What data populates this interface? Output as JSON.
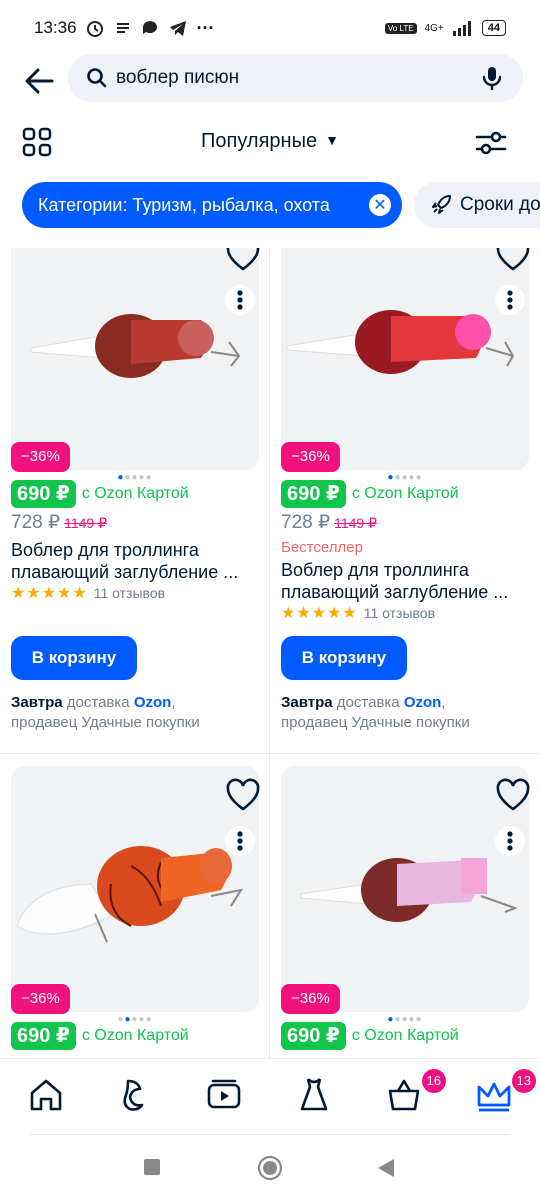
{
  "status_bar": {
    "time": "13:36",
    "network": "4G+",
    "lte": "Vo LTE",
    "battery": "44"
  },
  "search": {
    "query": "воблер писюн"
  },
  "sort": {
    "label": "Популярные"
  },
  "chips": {
    "active": "Категории: Туризм, рыбалка, охота",
    "delivery": "Сроки до"
  },
  "products": [
    {
      "discount": "−36%",
      "price_card": "690 ₽",
      "price_card_label": "с Ozon Картой",
      "price": "728 ₽",
      "price_old": "1149 ₽",
      "badge": "",
      "title": "Воблер для троллинга плавающий заглубление ...",
      "reviews": "11 отзывов",
      "cart": "В корзину",
      "delivery_when": "Завтра",
      "delivery_word": "доставка",
      "delivery_brand": "Ozon",
      "seller": "продавец Удачные покупки"
    },
    {
      "discount": "−36%",
      "price_card": "690 ₽",
      "price_card_label": "с Ozon Картой",
      "price": "728 ₽",
      "price_old": "1149 ₽",
      "badge": "Бестселлер",
      "title": "Воблер для троллинга плавающий заглубление ...",
      "reviews": "11 отзывов",
      "cart": "В корзину",
      "delivery_when": "Завтра",
      "delivery_word": "доставка",
      "delivery_brand": "Ozon",
      "seller": "продавец Удачные покупки"
    },
    {
      "discount": "−36%",
      "price_card": "690 ₽",
      "price_card_label": "с Ozon Картой"
    },
    {
      "discount": "−36%",
      "price_card": "690 ₽",
      "price_card_label": "с Ozon Картой"
    }
  ],
  "nav": {
    "cart_badge": "16",
    "premium_badge": "13"
  },
  "colors": {
    "brand": "#005bff",
    "discount": "#f1117e",
    "green": "#10c44c",
    "star": "#ffa800"
  },
  "icons": [
    "back-arrow-icon",
    "search-icon",
    "mic-icon",
    "grid-icon",
    "filter-icon",
    "rocket-icon",
    "heart-icon",
    "more-vertical-icon",
    "home-icon",
    "fresh-icon",
    "video-icon",
    "dress-icon",
    "cart-icon",
    "crown-icon"
  ]
}
